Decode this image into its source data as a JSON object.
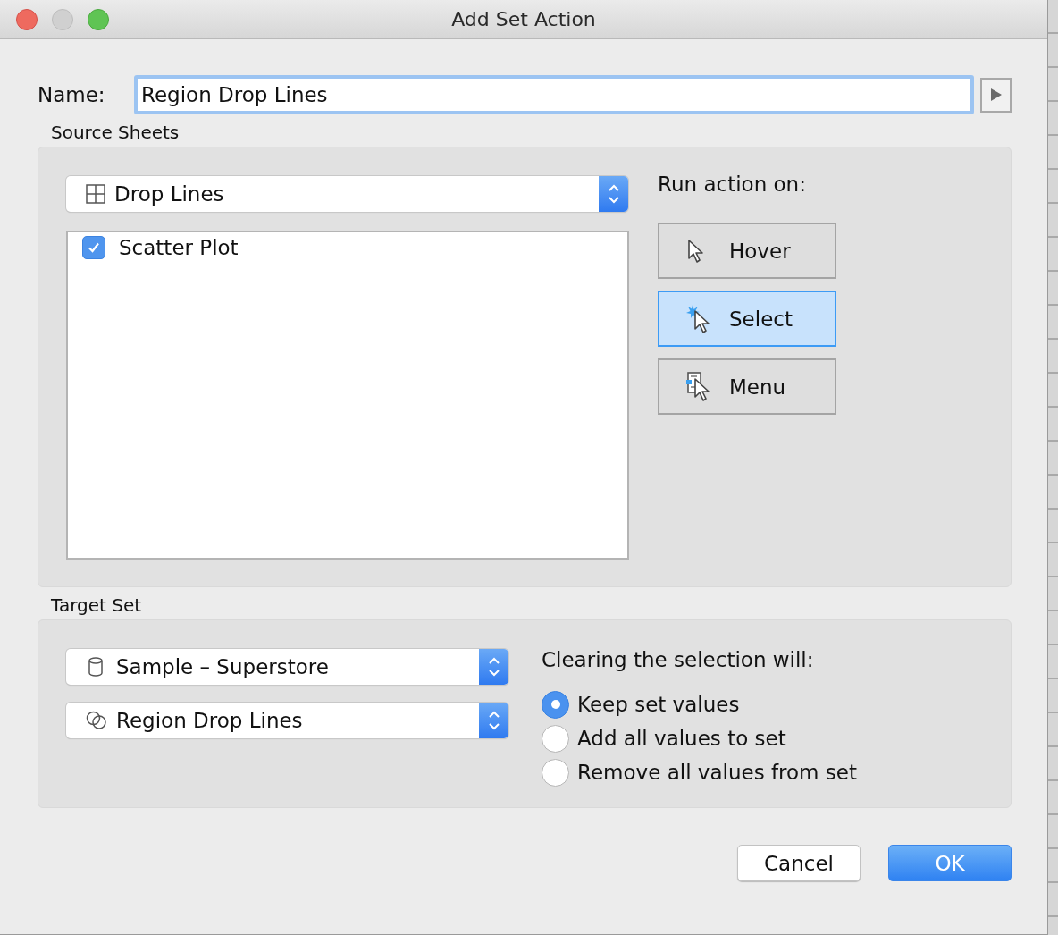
{
  "window": {
    "title": "Add Set Action"
  },
  "name_field": {
    "label": "Name:",
    "value": "Region Drop Lines"
  },
  "source_sheets": {
    "heading": "Source Sheets",
    "dropdown": "Drop Lines",
    "sheets": [
      {
        "label": "Scatter Plot",
        "checked": true
      }
    ],
    "run_action_label": "Run action on:",
    "run_action_buttons": [
      {
        "kind": "hover",
        "label": "Hover",
        "selected": false
      },
      {
        "kind": "select",
        "label": "Select",
        "selected": true
      },
      {
        "kind": "menu",
        "label": "Menu",
        "selected": false
      }
    ]
  },
  "target_set": {
    "heading": "Target Set",
    "data_source": "Sample – Superstore",
    "set": "Region Drop Lines",
    "clearing_label": "Clearing the selection will:",
    "options": [
      {
        "label": "Keep set values",
        "selected": true
      },
      {
        "label": "Add all values to set",
        "selected": false
      },
      {
        "label": "Remove all values from set",
        "selected": false
      }
    ]
  },
  "buttons": [
    {
      "kind": "cancel",
      "label": "Cancel"
    },
    {
      "kind": "ok",
      "label": "OK"
    }
  ]
}
